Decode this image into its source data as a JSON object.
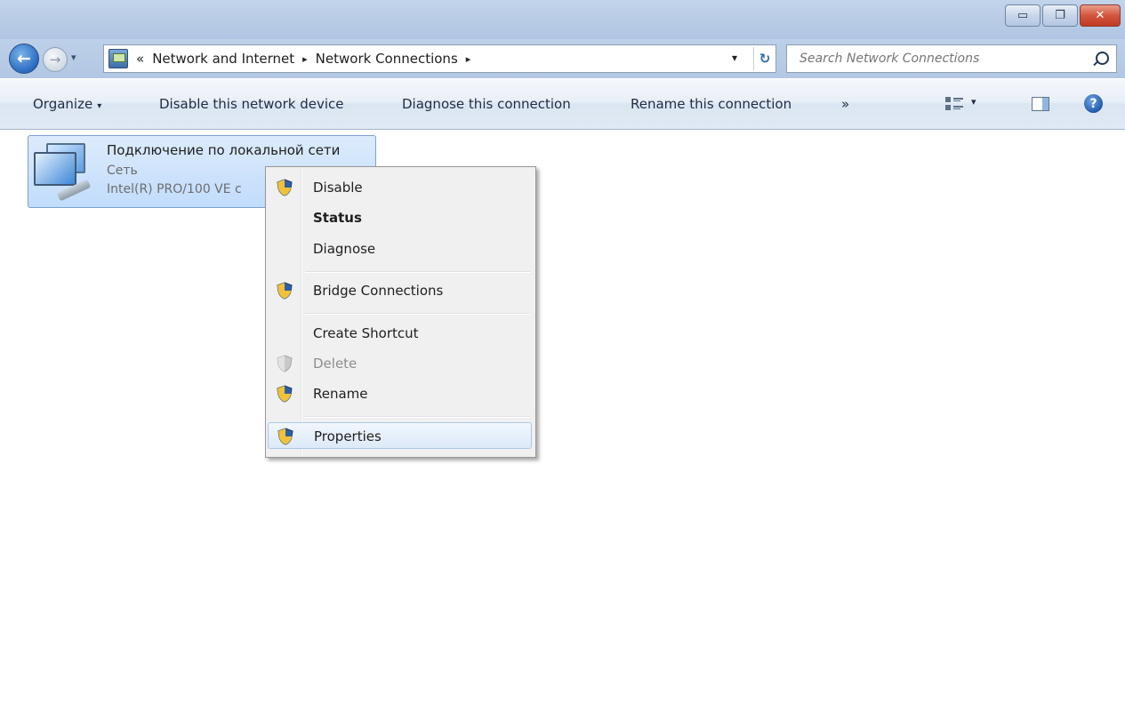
{
  "window": {
    "caption_buttons": [
      {
        "name": "minimize",
        "glyph": "▭"
      },
      {
        "name": "restore",
        "glyph": "❐"
      },
      {
        "name": "close",
        "glyph": "✕"
      }
    ]
  },
  "address_bar": {
    "back_glyph": "←",
    "forward_glyph": "→",
    "overflow": "«",
    "crumbs": [
      "Network and Internet",
      "Network Connections"
    ],
    "crumb_separator": "▸",
    "dropdown_glyph": "▾",
    "refresh_glyph": "↻"
  },
  "search": {
    "placeholder": "Search Network Connections"
  },
  "command_bar": {
    "organize": "Organize",
    "disable": "Disable this network device",
    "diagnose": "Diagnose this connection",
    "rename": "Rename this connection",
    "more": "»",
    "dropdown_glyph": "▾",
    "help_glyph": "?"
  },
  "connection": {
    "name": "Подключение по локальной сети",
    "status": "Сеть",
    "device": "Intel(R) PRO/100 VE c"
  },
  "context_menu": {
    "items": [
      {
        "label": "Disable",
        "shield": true,
        "bold": false,
        "disabled": false
      },
      {
        "label": "Status",
        "shield": false,
        "bold": true,
        "disabled": false
      },
      {
        "label": "Diagnose",
        "shield": false,
        "bold": false,
        "disabled": false
      },
      {
        "label": "Bridge Connections",
        "shield": true,
        "bold": false,
        "disabled": false
      },
      {
        "label": "Create Shortcut",
        "shield": false,
        "bold": false,
        "disabled": false
      },
      {
        "label": "Delete",
        "shield": true,
        "bold": false,
        "disabled": true
      },
      {
        "label": "Rename",
        "shield": true,
        "bold": false,
        "disabled": false
      },
      {
        "label": "Properties",
        "shield": true,
        "bold": false,
        "disabled": false,
        "highlighted": true
      }
    ]
  },
  "colors": {
    "accent": "#3c7fd0",
    "selection": "#c1dcfc",
    "menu_bg": "#f0f0f0"
  }
}
